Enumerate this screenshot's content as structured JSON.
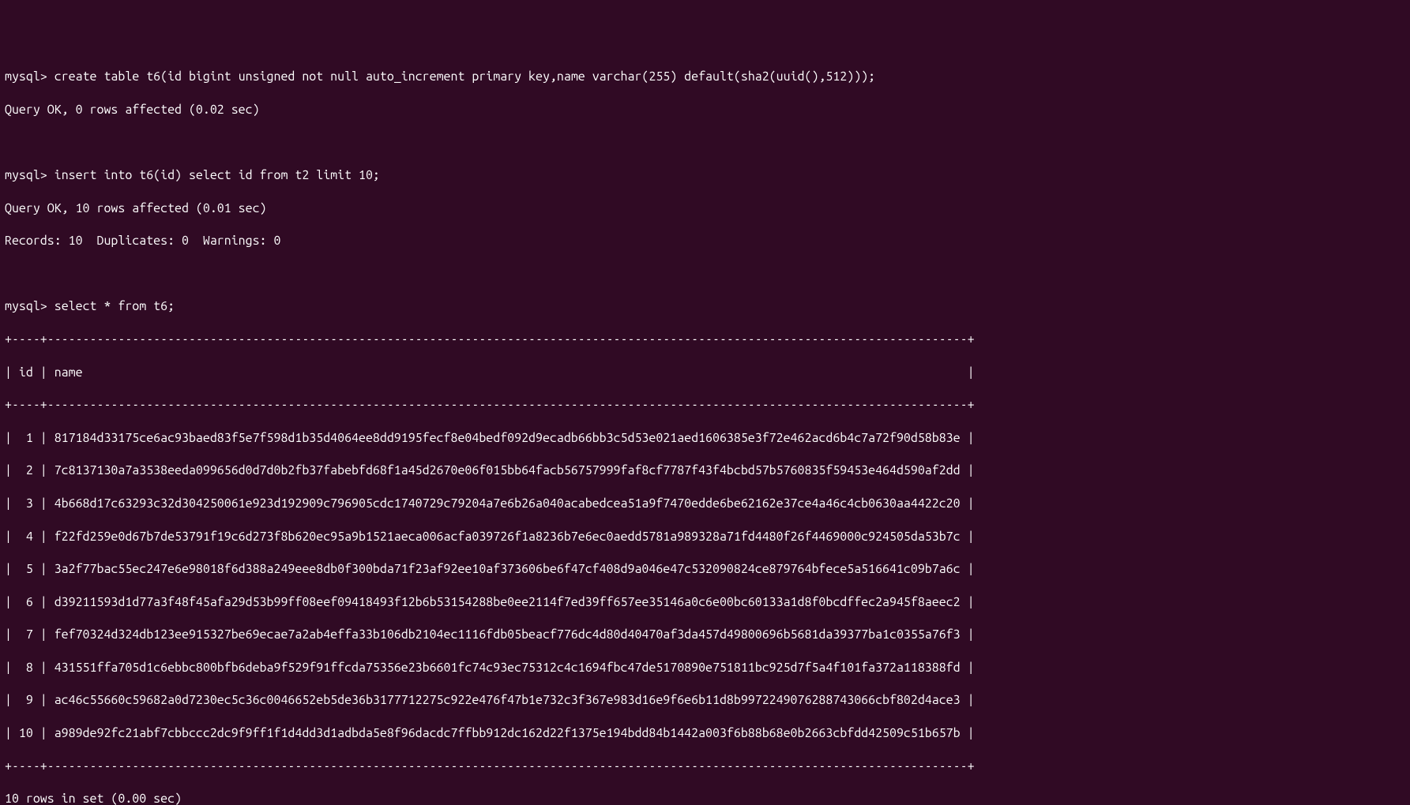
{
  "terminal": {
    "prompt": "mysql>",
    "cmd1": "create table t6(id bigint unsigned not null auto_increment primary key,name varchar(255) default(sha2(uuid(),512)));",
    "resp1": "Query OK, 0 rows affected (0.02 sec)",
    "cmd2": "insert into t6(id) select id from t2 limit 10;",
    "resp2_l1": "Query OK, 10 rows affected (0.01 sec)",
    "resp2_l2": "Records: 10  Duplicates: 0  Warnings: 0",
    "cmd3": "select * from t6;",
    "table_sep": "+----+----------------------------------------------------------------------------------------------------------------------------------+",
    "table_hdr": "| id | name                                                                                                                             |",
    "rows": [
      "|  1 | 817184d33175ce6ac93baed83f5e7f598d1b35d4064ee8dd9195fecf8e04bedf092d9ecadb66bb3c5d53e021aed1606385e3f72e462acd6b4c7a72f90d58b83e |",
      "|  2 | 7c8137130a7a3538eeda099656d0d7d0b2fb37fabebfd68f1a45d2670e06f015bb64facb56757999faf8cf7787f43f4bcbd57b5760835f59453e464d590af2dd |",
      "|  3 | 4b668d17c63293c32d304250061e923d192909c796905cdc1740729c79204a7e6b26a040acabedcea51a9f7470edde6be62162e37ce4a46c4cb0630aa4422c20 |",
      "|  4 | f22fd259e0d67b7de53791f19c6d273f8b620ec95a9b1521aeca006acfa039726f1a8236b7e6ec0aedd5781a989328a71fd4480f26f4469000c924505da53b7c |",
      "|  5 | 3a2f77bac55ec247e6e98018f6d388a249eee8db0f300bda71f23af92ee10af373606be6f47cf408d9a046e47c532090824ce879764bfece5a516641c09b7a6c |",
      "|  6 | d39211593d1d77a3f48f45afa29d53b99ff08eef09418493f12b6b53154288be0ee2114f7ed39ff657ee35146a0c6e00bc60133a1d8f0bcdffec2a945f8aeec2 |",
      "|  7 | fef70324d324db123ee915327be69ecae7a2ab4effa33b106db2104ec1116fdb05beacf776dc4d80d40470af3da457d49800696b5681da39377ba1c0355a76f3 |",
      "|  8 | 431551ffa705d1c6ebbc800bfb6deba9f529f91ffcda75356e23b6601fc74c93ec75312c4c1694fbc47de5170890e751811bc925d7f5a4f101fa372a118388fd |",
      "|  9 | ac46c55660c59682a0d7230ec5c36c0046652eb5de36b3177712275c922e476f47b1e732c3f367e983d16e9f6e6b11d8b9972249076288743066cbf802d4ace3 |",
      "| 10 | a989de92fc21abf7cbbccc2dc9f9ff1f1d4dd3d1adbda5e8f96dacdc7ffbb912dc162d22f1375e194bdd84b1442a003f6b88b68e0b2663cbfdd42509c51b657b |"
    ],
    "footer": "10 rows in set (0.00 sec)"
  }
}
